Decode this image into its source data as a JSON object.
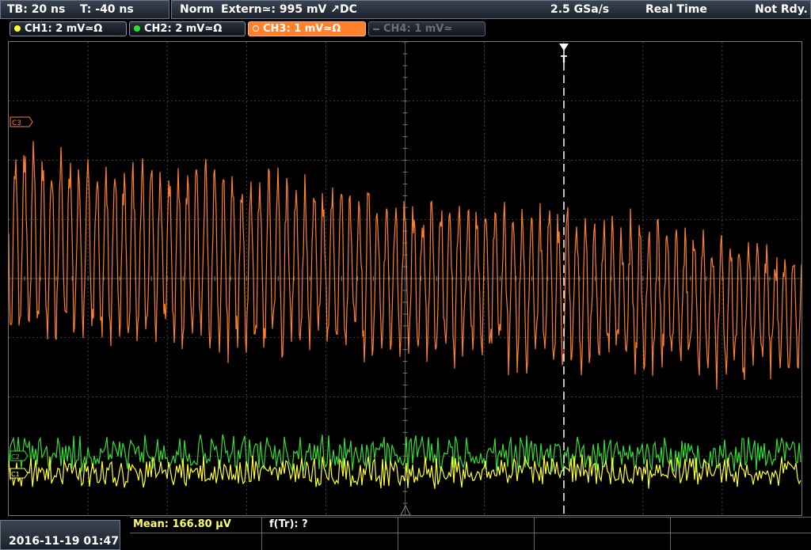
{
  "header": {
    "timebase": "TB: 20 ns",
    "trigger_time": "T: -40 ns",
    "trigger_mode": "Norm",
    "trigger_source": "Extern≃: 995 mV ↗DC",
    "sample_rate": "2.5 GSa/s",
    "acq_mode": "Real Time",
    "status": "Not Rdy."
  },
  "channels": [
    {
      "label": "CH1: 2 mV≃Ω",
      "color": "#ffff33",
      "state": "on"
    },
    {
      "label": "CH2: 2 mV≃Ω",
      "color": "#33dd33",
      "state": "on"
    },
    {
      "label": "CH3: 1 mV≃Ω",
      "color": "#ff7f2a",
      "state": "selected"
    },
    {
      "label": "CH4: 1 mV≃",
      "color": "#6b6f75",
      "state": "off"
    }
  ],
  "markers": {
    "ch3": "C3",
    "ch2": "C2",
    "ch1": "C1",
    "trigger": "T"
  },
  "footer": {
    "datetime": "2016-11-19 01:47",
    "mean": "Mean: 166.80 µV",
    "freq": "f(Tr): ?"
  },
  "colors": {
    "ch1": "#ffff33",
    "ch2": "#33dd33",
    "ch3": "#ff7f2a",
    "grid": "#555555",
    "measure_label": "#ffff66"
  }
}
